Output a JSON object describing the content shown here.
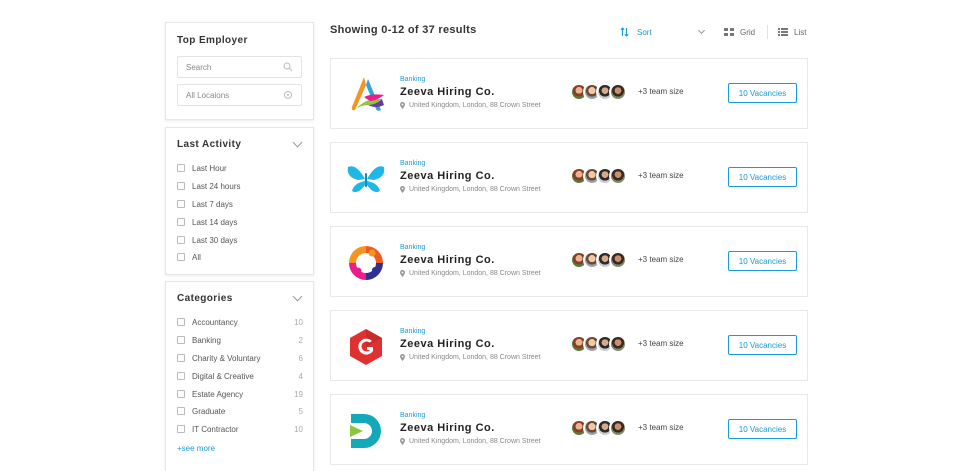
{
  "sidebar": {
    "top_employer": {
      "title": "Top Employer",
      "search_placeholder": "Search",
      "location_placeholder": "All Locaions"
    },
    "last_activity": {
      "title": "Last Activity",
      "items": [
        "Last Hour",
        "Last 24 hours",
        "Last 7 days",
        "Last 14 days",
        "Last 30 days",
        "All"
      ]
    },
    "categories": {
      "title": "Categories",
      "items": [
        {
          "label": "Accountancy",
          "count": "10"
        },
        {
          "label": "Banking",
          "count": "2"
        },
        {
          "label": "Charity & Voluntary",
          "count": "6"
        },
        {
          "label": "Digital & Creative",
          "count": "4"
        },
        {
          "label": "Estate Agency",
          "count": "19"
        },
        {
          "label": "Graduate",
          "count": "5"
        },
        {
          "label": "IT Contractor",
          "count": "10"
        }
      ],
      "see_more": "+see more"
    }
  },
  "main": {
    "results_text": "Showing 0-12 of 37 results",
    "sort_label": "Sort",
    "grid_label": "Grid",
    "list_label": "List",
    "cards": [
      {
        "category": "Banking",
        "name": "Zeeva Hiring Co.",
        "location": "United Kingdom, London, 88 Crown Street",
        "team": "+3 team size",
        "vacancies": "10 Vacancies",
        "logo": "ribbon-a-logo"
      },
      {
        "category": "Banking",
        "name": "Zeeva Hiring Co.",
        "location": "United Kingdom, London, 88 Crown Street",
        "team": "+3 team size",
        "vacancies": "10 Vacancies",
        "logo": "butterfly-logo"
      },
      {
        "category": "Banking",
        "name": "Zeeva Hiring Co.",
        "location": "United Kingdom, London, 88 Crown Street",
        "team": "+3 team size",
        "vacancies": "10 Vacancies",
        "logo": "people-circle-logo"
      },
      {
        "category": "Banking",
        "name": "Zeeva Hiring Co.",
        "location": "United Kingdom, London, 88 Crown Street",
        "team": "+3 team size",
        "vacancies": "10 Vacancies",
        "logo": "g-hexagon-logo"
      },
      {
        "category": "Banking",
        "name": "Zeeva Hiring Co.",
        "location": "United Kingdom, London, 88 Crown Street",
        "team": "+3 team size",
        "vacancies": "10 Vacancies",
        "logo": "d-play-logo"
      }
    ]
  },
  "colors": {
    "accent": "#1a9ad6",
    "border": "#e8e8e8"
  }
}
